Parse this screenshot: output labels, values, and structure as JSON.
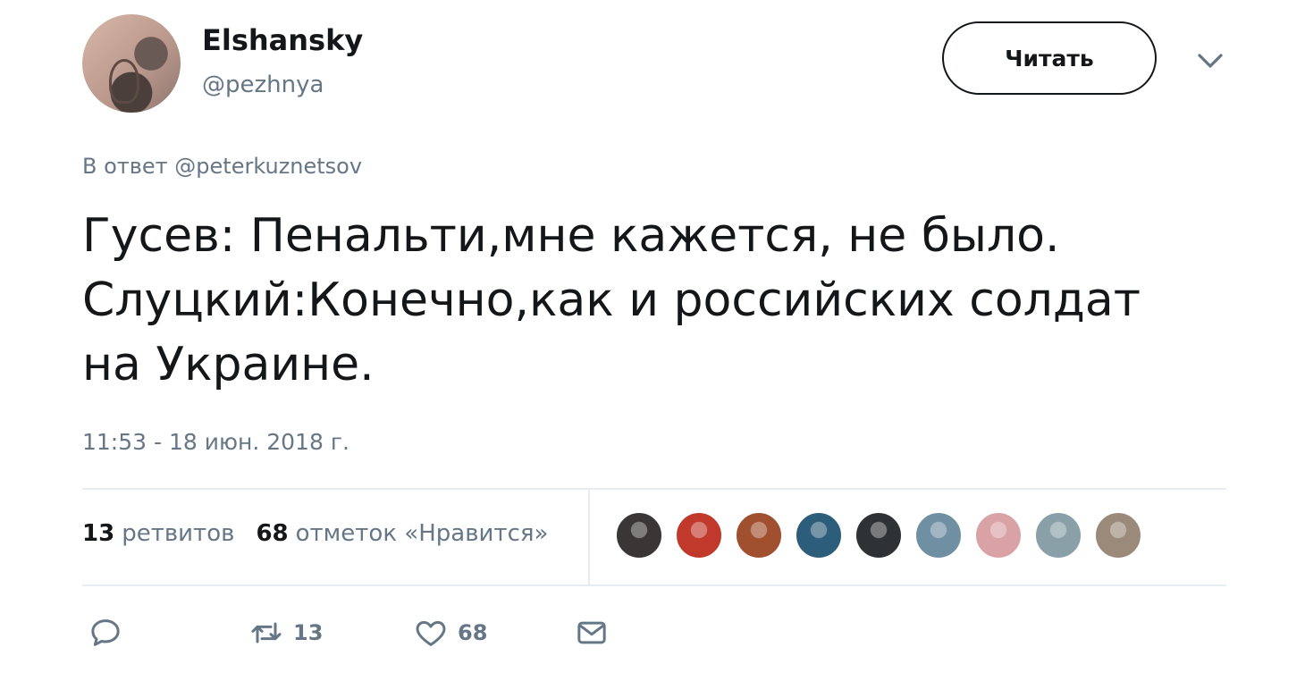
{
  "author": {
    "display_name": "Elshansky",
    "handle": "@pezhnya"
  },
  "follow_button": {
    "label": "Читать"
  },
  "reply": {
    "prefix": "В ответ ",
    "mention": "@peterkuznetsov"
  },
  "tweet": {
    "text": "Гусев: Пенальти,мне кажется, не было.\nСлуцкий:Конечно,как и российских солдат\nна Украине.",
    "timestamp": "11:53 - 18 июн. 2018 г."
  },
  "stats": {
    "retweets_count": "13",
    "retweets_label": "ретвитов",
    "likes_count": "68",
    "likes_label": "отметок «Нравится»"
  },
  "likers": [
    {
      "name": "liker-1",
      "color": "#3a3636"
    },
    {
      "name": "liker-2",
      "color": "#c0392b"
    },
    {
      "name": "liker-3",
      "color": "#a0502e"
    },
    {
      "name": "liker-4",
      "color": "#2c5d7a"
    },
    {
      "name": "liker-5",
      "color": "#2f3235"
    },
    {
      "name": "liker-6",
      "color": "#6f8fa2"
    },
    {
      "name": "liker-7",
      "color": "#d9a2a5"
    },
    {
      "name": "liker-8",
      "color": "#8aa0a8"
    },
    {
      "name": "liker-9",
      "color": "#9b8a7a"
    }
  ],
  "actions": {
    "reply_icon": "reply-icon",
    "retweet_icon": "retweet-icon",
    "retweet_count": "13",
    "like_icon": "heart-icon",
    "like_count": "68",
    "message_icon": "envelope-icon"
  },
  "colors": {
    "text": "#14171a",
    "muted": "#657786",
    "divider": "#e6ecf0"
  }
}
